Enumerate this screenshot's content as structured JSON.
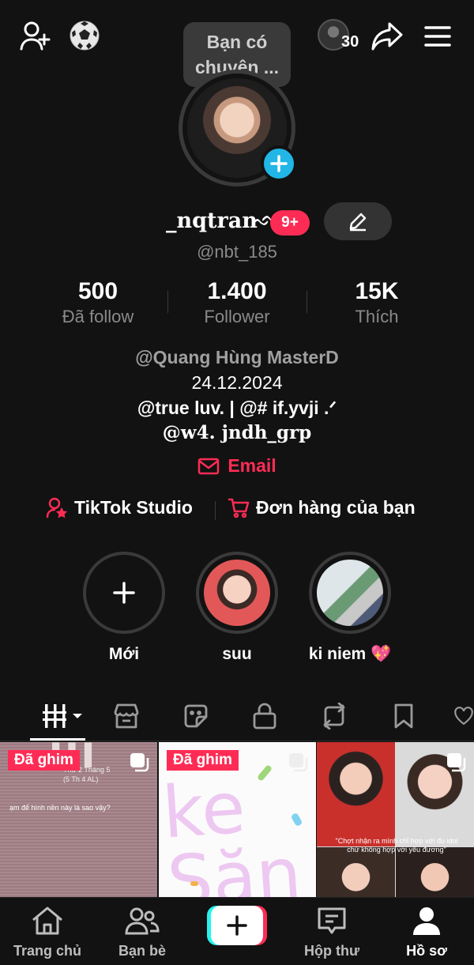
{
  "header": {
    "tooltip": "Bạn có\nchuyện ...",
    "friends_count": "30"
  },
  "profile": {
    "username": "_nqtran",
    "name_decor": "ᨒ",
    "notification_badge": "9+",
    "handle": "@nbt_185"
  },
  "stats": [
    {
      "value": "500",
      "label": "Đã follow"
    },
    {
      "value": "1.400",
      "label": "Follower"
    },
    {
      "value": "15K",
      "label": "Thích"
    }
  ],
  "bio": {
    "line1": "@Quang Hùng MasterD",
    "line2": "24.12.2024",
    "line3": "@true luv. | @# if.yvji .ᐟ",
    "line4": "@w4. jndh_grp"
  },
  "email_label": "Email",
  "links": {
    "studio": "TikTok Studio",
    "orders": "Đơn hàng của bạn"
  },
  "stories": [
    {
      "label": "Mới"
    },
    {
      "label": "suu"
    },
    {
      "label": "ki niem 💖"
    }
  ],
  "grid": {
    "pinned_label_1": "Đã ghim",
    "pinned_label_2": "Đã ghim",
    "cell1_top": "Thứ 2 Tháng 5",
    "cell1_sub": "(5 Th 4 AL)",
    "cell1_caption": "ạm để hình nền này là sao vậy?",
    "cell2_text": "ke Săn",
    "cell3_caption": "\"Chợt nhận ra mình chỉ hợp với đu idol chứ không hợp với yêu đương\""
  },
  "nav": {
    "home": "Trang chủ",
    "friends": "Bạn bè",
    "inbox": "Hộp thư",
    "profile": "Hồ sơ"
  },
  "colors": {
    "background": "#121212",
    "accent": "#fe2c55",
    "cyan": "#25f4ee",
    "muted": "#8a8a8a"
  }
}
